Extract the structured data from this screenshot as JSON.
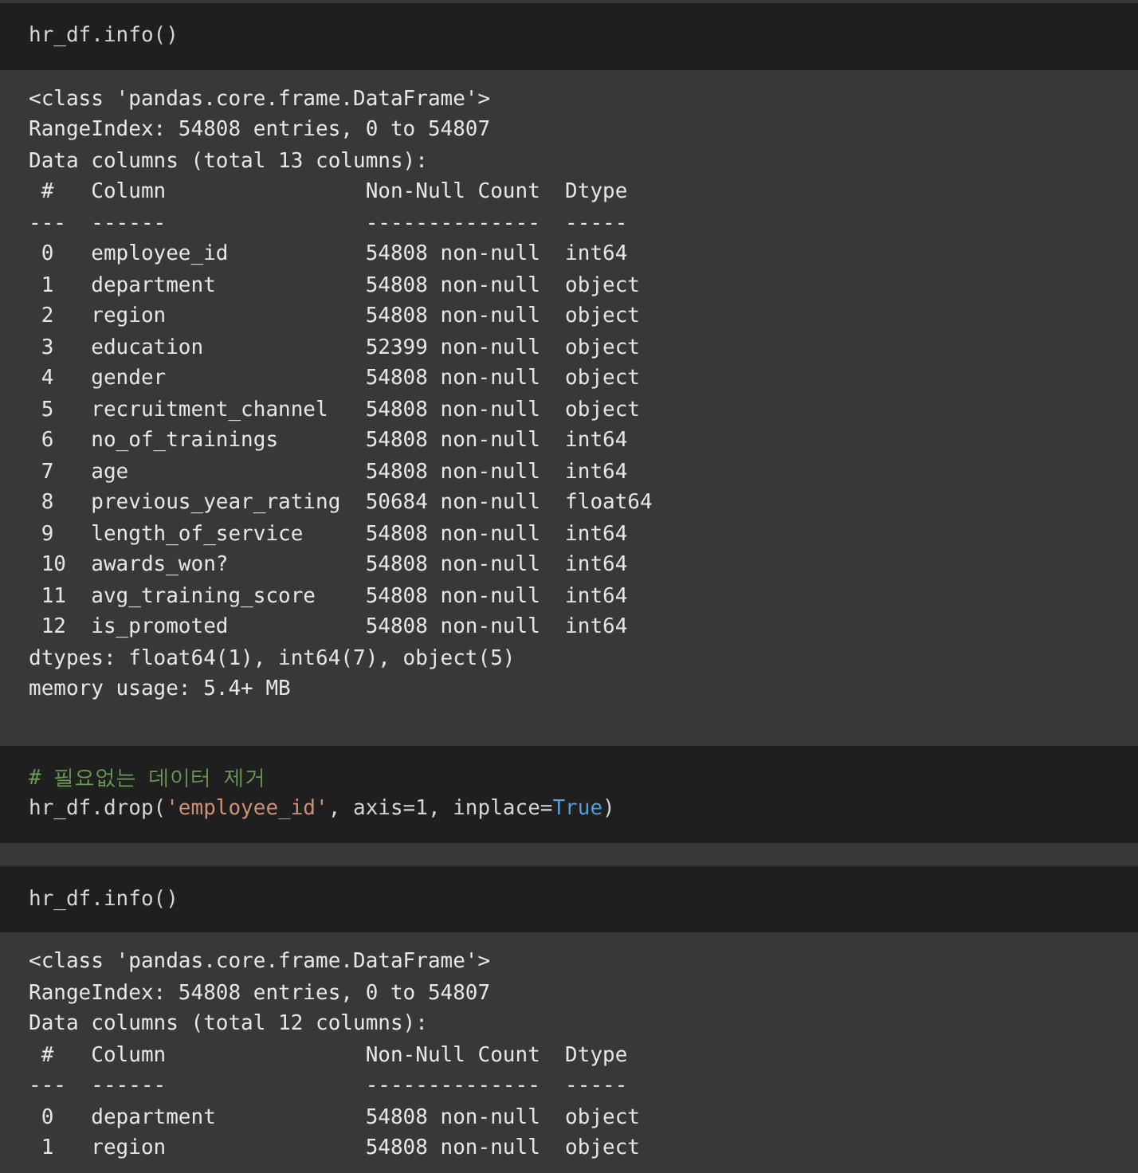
{
  "cells": [
    {
      "code": [
        [
          {
            "kind": "plain",
            "text": "hr_df.info()"
          }
        ]
      ],
      "output": [
        "<class 'pandas.core.frame.DataFrame'>",
        "RangeIndex: 54808 entries, 0 to 54807",
        "Data columns (total 13 columns):",
        " #   Column                Non-Null Count  Dtype  ",
        "---  ------                --------------  -----  ",
        " 0   employee_id           54808 non-null  int64  ",
        " 1   department            54808 non-null  object ",
        " 2   region                54808 non-null  object ",
        " 3   education             52399 non-null  object ",
        " 4   gender                54808 non-null  object ",
        " 5   recruitment_channel   54808 non-null  object ",
        " 6   no_of_trainings       54808 non-null  int64  ",
        " 7   age                   54808 non-null  int64  ",
        " 8   previous_year_rating  50684 non-null  float64",
        " 9   length_of_service     54808 non-null  int64  ",
        " 10  awards_won?           54808 non-null  int64  ",
        " 11  avg_training_score    54808 non-null  int64  ",
        " 12  is_promoted           54808 non-null  int64  ",
        "dtypes: float64(1), int64(7), object(5)",
        "memory usage: 5.4+ MB"
      ]
    },
    {
      "code": [
        [
          {
            "kind": "comment",
            "text": "# 필요없는 데이터 제거"
          }
        ],
        [
          {
            "kind": "plain",
            "text": "hr_df.drop("
          },
          {
            "kind": "string",
            "text": "'employee_id'"
          },
          {
            "kind": "plain",
            "text": ", axis=1, inplace="
          },
          {
            "kind": "keyword",
            "text": "True"
          },
          {
            "kind": "plain",
            "text": ")"
          }
        ]
      ]
    },
    {
      "code": [
        [
          {
            "kind": "plain",
            "text": "hr_df.info()"
          }
        ]
      ],
      "output": [
        "<class 'pandas.core.frame.DataFrame'>",
        "RangeIndex: 54808 entries, 0 to 54807",
        "Data columns (total 12 columns):",
        " #   Column                Non-Null Count  Dtype  ",
        "---  ------                --------------  -----  ",
        " 0   department            54808 non-null  object ",
        " 1   region                54808 non-null  object "
      ]
    }
  ]
}
